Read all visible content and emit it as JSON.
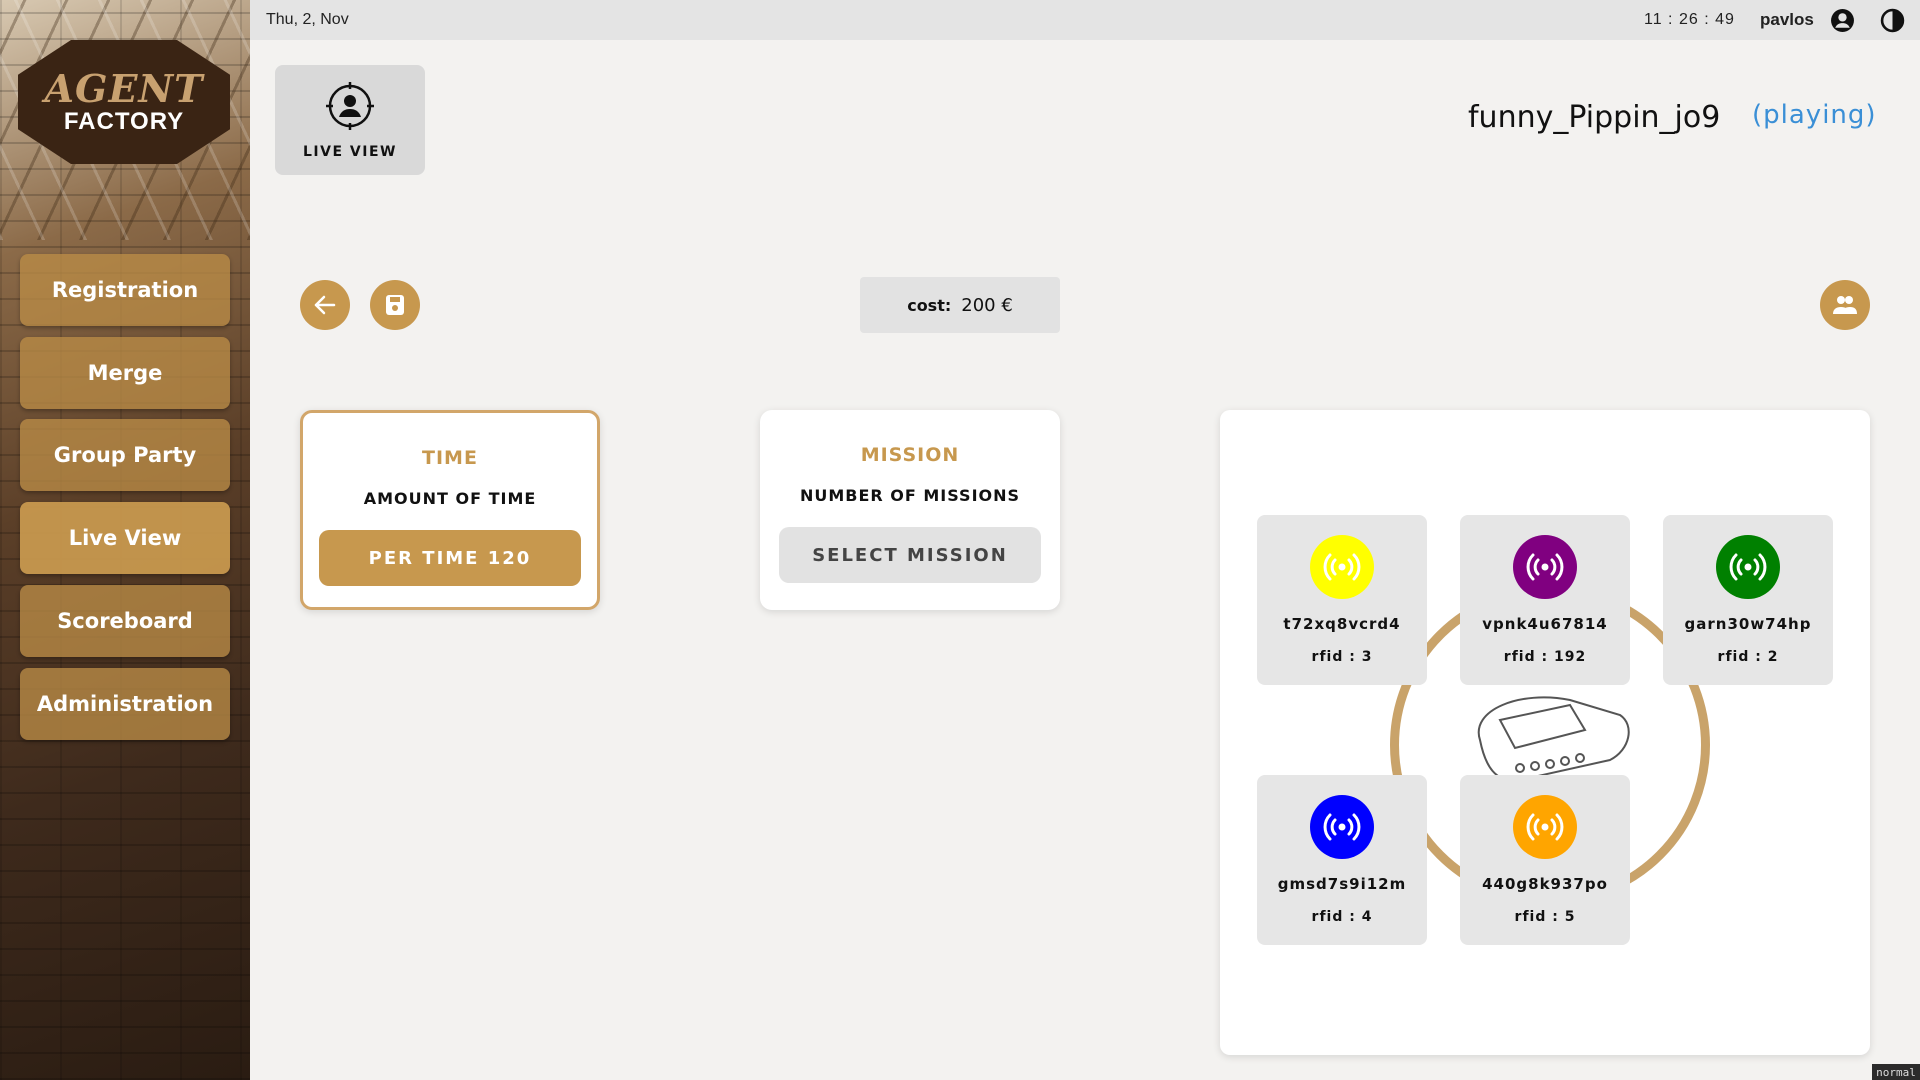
{
  "topbar": {
    "date": "Thu, 2, Nov",
    "time": "11  :  26  :  49",
    "username": "pavlos"
  },
  "sidebar": {
    "logo_line1": "AGENT",
    "logo_line2": "FACTORY",
    "items": [
      {
        "label": "Registration"
      },
      {
        "label": "Merge"
      },
      {
        "label": "Group Party"
      },
      {
        "label": "Live View"
      },
      {
        "label": "Scoreboard"
      },
      {
        "label": "Administration"
      }
    ]
  },
  "main": {
    "live_view_label": "LIVE  VIEW",
    "player_name": "funny_Pippin_jo9",
    "player_status": "(playing)",
    "cost_label": "cost:",
    "cost_value": "200 €",
    "time_card": {
      "title": "TIME",
      "subtitle": "AMOUNT OF TIME",
      "button": "PER TIME 120"
    },
    "mission_card": {
      "title": "MISSION",
      "subtitle": "NUMBER OF MISSIONS",
      "button": "SELECT MISSION"
    },
    "users": [
      {
        "code": "t72xq8vcrd4",
        "rfid": "rfid : 3",
        "color": "#ffff00"
      },
      {
        "code": "vpnk4u67814",
        "rfid": "rfid : 192",
        "color": "#800080"
      },
      {
        "code": "garn30w74hp",
        "rfid": "rfid : 2",
        "color": "#008000"
      },
      {
        "code": "gmsd7s9i12m",
        "rfid": "rfid : 4",
        "color": "#0000ff"
      },
      {
        "code": "440g8k937po",
        "rfid": "rfid : 5",
        "color": "#ffa500"
      }
    ]
  },
  "mode_badge": "normal",
  "colors": {
    "accent": "#c7984e",
    "status": "#3a8fd6"
  }
}
